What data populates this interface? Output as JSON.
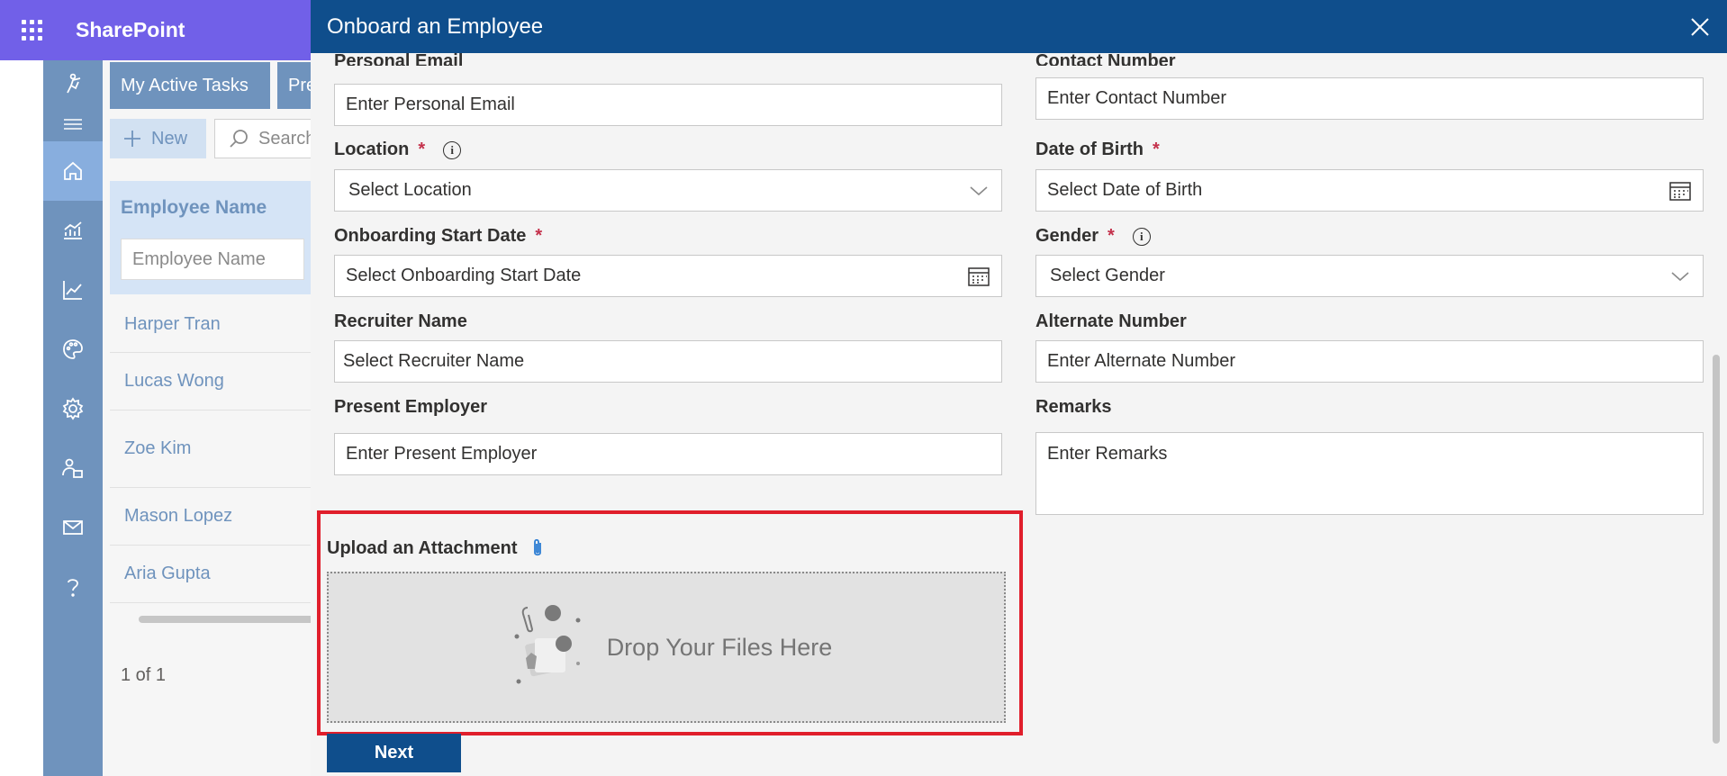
{
  "app": {
    "title": "SharePoint"
  },
  "background": {
    "tabs": [
      "My Active Tasks",
      "Pre"
    ],
    "new_label": "New",
    "search_placeholder": "Search",
    "column_title": "Employee Name",
    "column_filter_placeholder": "Employee Name",
    "rows": [
      "Harper Tran",
      "Lucas Wong",
      "Zoe Kim",
      "Mason Lopez",
      "Aria Gupta"
    ],
    "pager": "1 of 1"
  },
  "panel": {
    "title": "Onboard an Employee",
    "fields": {
      "personal_email": {
        "label": "Personal Email",
        "placeholder": "Enter Personal Email"
      },
      "contact_number": {
        "label": "Contact Number",
        "placeholder": "Enter Contact Number"
      },
      "location": {
        "label": "Location",
        "placeholder": "Select Location",
        "required": "*"
      },
      "date_of_birth": {
        "label": "Date of Birth",
        "placeholder": "Select Date of Birth",
        "required": "*"
      },
      "onboarding_start_date": {
        "label": "Onboarding Start Date",
        "placeholder": "Select Onboarding Start Date",
        "required": "*"
      },
      "gender": {
        "label": "Gender",
        "placeholder": "Select Gender",
        "required": "*"
      },
      "recruiter_name": {
        "label": "Recruiter Name",
        "placeholder": "Select Recruiter Name"
      },
      "alternate_number": {
        "label": "Alternate Number",
        "placeholder": "Enter Alternate Number"
      },
      "present_employer": {
        "label": "Present Employer",
        "placeholder": "Enter Present Employer"
      },
      "remarks": {
        "label": "Remarks",
        "placeholder": "Enter Remarks"
      }
    },
    "upload": {
      "label": "Upload an Attachment",
      "drop_text": "Drop Your Files Here"
    },
    "next_label": "Next"
  },
  "colors": {
    "sp_bar": "#7160e8",
    "panel_header": "#0f4e8c",
    "rail": "#6f93bd",
    "highlight": "#e01e2b"
  },
  "icons": [
    "waffle-icon",
    "close-icon",
    "info-icon",
    "chevron-down-icon",
    "calendar-icon",
    "paperclip-icon",
    "add-icon",
    "search-icon"
  ]
}
